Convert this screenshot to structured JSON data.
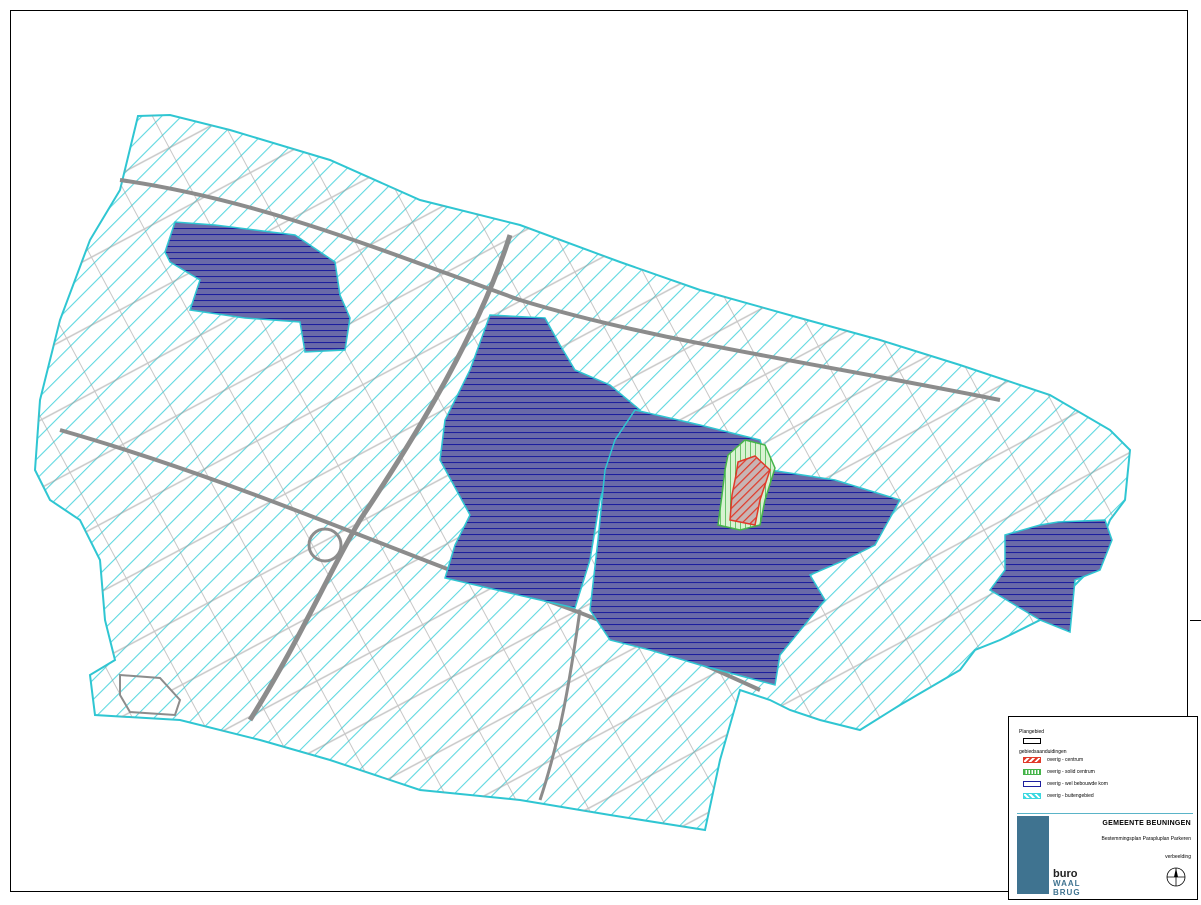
{
  "legend": {
    "title": "Plangebied",
    "section": "gebiedsaanduidingen",
    "items": [
      {
        "label": "overig - centrum",
        "color": "#e03a2a"
      },
      {
        "label": "overig - solid centrum",
        "color": "#45b44a"
      },
      {
        "label": "overig - wel bebouwde kom",
        "color": "#1d1f9e"
      },
      {
        "label": "overig - buitengebied",
        "color": "#3cd8e0"
      }
    ]
  },
  "titleblock": {
    "municipality": "GEMEENTE BEUNINGEN",
    "plan_name": "Bestemmingsplan Parapluplan Parkeren",
    "status": "verbeelding",
    "firm_line1": "buro",
    "firm_line2": "WAAL",
    "firm_line3": "BRUG"
  },
  "colors": {
    "outline": "#2fc6d2",
    "hatch_outer": "#5fd8e0",
    "built_area": "#6a6aa8",
    "centrum": "#e03a2a",
    "centrum_edge": "#45b44a",
    "roads": "#9a9a9a"
  }
}
